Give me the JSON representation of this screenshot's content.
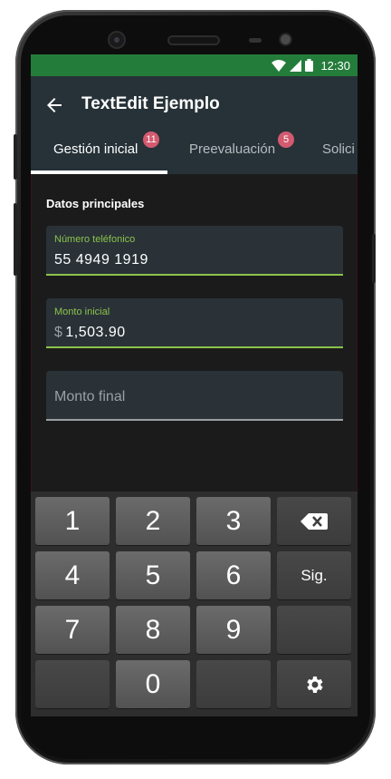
{
  "status_bar": {
    "time": "12:30",
    "icons": [
      "wifi-icon",
      "signal-icon",
      "battery-icon"
    ],
    "color": "#247c3b"
  },
  "app_bar": {
    "title": "TextEdit Ejemplo",
    "back_icon": "arrow-left-icon",
    "color": "#263238"
  },
  "tabs": [
    {
      "label": "Gestión inicial",
      "badge": "11",
      "active": true
    },
    {
      "label": "Preevaluación",
      "badge": "5",
      "active": false
    },
    {
      "label": "Solici",
      "badge": "",
      "active": false
    }
  ],
  "form": {
    "section_title": "Datos principales",
    "phone": {
      "label": "Número teléfonico",
      "value": "55 4949 1919"
    },
    "initial_amount": {
      "label": "Monto inicial",
      "prefix": "$",
      "value": "1,503.90"
    },
    "final_amount": {
      "placeholder": "Monto final"
    }
  },
  "keyboard": {
    "keys": [
      "1",
      "2",
      "3",
      "4",
      "5",
      "6",
      "7",
      "8",
      "9",
      "0"
    ],
    "next_label": "Sig.",
    "backspace_icon": "backspace-icon",
    "settings_icon": "gear-icon"
  },
  "colors": {
    "accent": "#8bc34a",
    "badge": "#d45a70"
  }
}
